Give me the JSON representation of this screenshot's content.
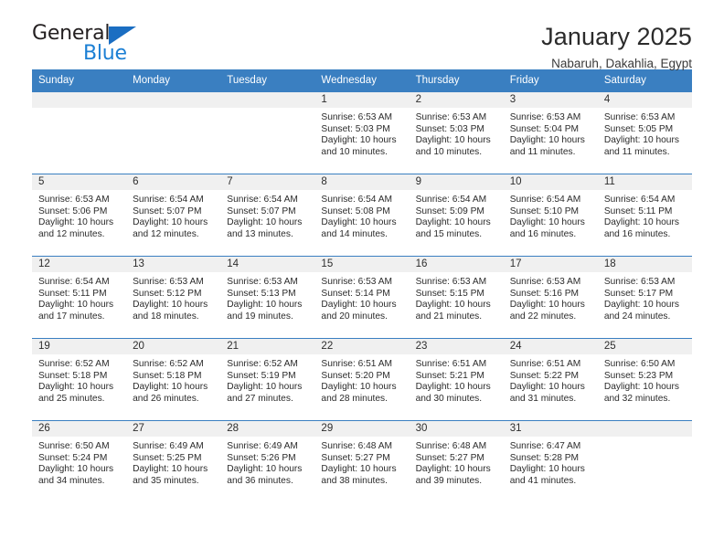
{
  "logo": {
    "word1": "General",
    "word2": "Blue",
    "triangle_color": "#1b6ec2",
    "word2_color": "#1b7fd4"
  },
  "header": {
    "title": "January 2025",
    "subtitle": "Nabaruh, Dakahlia, Egypt"
  },
  "theme": {
    "header_blue": "#3a7fc1",
    "band_gray": "#f0f0f0"
  },
  "weekdays": [
    "Sunday",
    "Monday",
    "Tuesday",
    "Wednesday",
    "Thursday",
    "Friday",
    "Saturday"
  ],
  "weeks": [
    [
      {
        "day": "",
        "empty": true
      },
      {
        "day": "",
        "empty": true
      },
      {
        "day": "",
        "empty": true
      },
      {
        "day": "1",
        "sunrise": "Sunrise: 6:53 AM",
        "sunset": "Sunset: 5:03 PM",
        "daylight": "Daylight: 10 hours and 10 minutes."
      },
      {
        "day": "2",
        "sunrise": "Sunrise: 6:53 AM",
        "sunset": "Sunset: 5:03 PM",
        "daylight": "Daylight: 10 hours and 10 minutes."
      },
      {
        "day": "3",
        "sunrise": "Sunrise: 6:53 AM",
        "sunset": "Sunset: 5:04 PM",
        "daylight": "Daylight: 10 hours and 11 minutes."
      },
      {
        "day": "4",
        "sunrise": "Sunrise: 6:53 AM",
        "sunset": "Sunset: 5:05 PM",
        "daylight": "Daylight: 10 hours and 11 minutes."
      }
    ],
    [
      {
        "day": "5",
        "sunrise": "Sunrise: 6:53 AM",
        "sunset": "Sunset: 5:06 PM",
        "daylight": "Daylight: 10 hours and 12 minutes."
      },
      {
        "day": "6",
        "sunrise": "Sunrise: 6:54 AM",
        "sunset": "Sunset: 5:07 PM",
        "daylight": "Daylight: 10 hours and 12 minutes."
      },
      {
        "day": "7",
        "sunrise": "Sunrise: 6:54 AM",
        "sunset": "Sunset: 5:07 PM",
        "daylight": "Daylight: 10 hours and 13 minutes."
      },
      {
        "day": "8",
        "sunrise": "Sunrise: 6:54 AM",
        "sunset": "Sunset: 5:08 PM",
        "daylight": "Daylight: 10 hours and 14 minutes."
      },
      {
        "day": "9",
        "sunrise": "Sunrise: 6:54 AM",
        "sunset": "Sunset: 5:09 PM",
        "daylight": "Daylight: 10 hours and 15 minutes."
      },
      {
        "day": "10",
        "sunrise": "Sunrise: 6:54 AM",
        "sunset": "Sunset: 5:10 PM",
        "daylight": "Daylight: 10 hours and 16 minutes."
      },
      {
        "day": "11",
        "sunrise": "Sunrise: 6:54 AM",
        "sunset": "Sunset: 5:11 PM",
        "daylight": "Daylight: 10 hours and 16 minutes."
      }
    ],
    [
      {
        "day": "12",
        "sunrise": "Sunrise: 6:54 AM",
        "sunset": "Sunset: 5:11 PM",
        "daylight": "Daylight: 10 hours and 17 minutes."
      },
      {
        "day": "13",
        "sunrise": "Sunrise: 6:53 AM",
        "sunset": "Sunset: 5:12 PM",
        "daylight": "Daylight: 10 hours and 18 minutes."
      },
      {
        "day": "14",
        "sunrise": "Sunrise: 6:53 AM",
        "sunset": "Sunset: 5:13 PM",
        "daylight": "Daylight: 10 hours and 19 minutes."
      },
      {
        "day": "15",
        "sunrise": "Sunrise: 6:53 AM",
        "sunset": "Sunset: 5:14 PM",
        "daylight": "Daylight: 10 hours and 20 minutes."
      },
      {
        "day": "16",
        "sunrise": "Sunrise: 6:53 AM",
        "sunset": "Sunset: 5:15 PM",
        "daylight": "Daylight: 10 hours and 21 minutes."
      },
      {
        "day": "17",
        "sunrise": "Sunrise: 6:53 AM",
        "sunset": "Sunset: 5:16 PM",
        "daylight": "Daylight: 10 hours and 22 minutes."
      },
      {
        "day": "18",
        "sunrise": "Sunrise: 6:53 AM",
        "sunset": "Sunset: 5:17 PM",
        "daylight": "Daylight: 10 hours and 24 minutes."
      }
    ],
    [
      {
        "day": "19",
        "sunrise": "Sunrise: 6:52 AM",
        "sunset": "Sunset: 5:18 PM",
        "daylight": "Daylight: 10 hours and 25 minutes."
      },
      {
        "day": "20",
        "sunrise": "Sunrise: 6:52 AM",
        "sunset": "Sunset: 5:18 PM",
        "daylight": "Daylight: 10 hours and 26 minutes."
      },
      {
        "day": "21",
        "sunrise": "Sunrise: 6:52 AM",
        "sunset": "Sunset: 5:19 PM",
        "daylight": "Daylight: 10 hours and 27 minutes."
      },
      {
        "day": "22",
        "sunrise": "Sunrise: 6:51 AM",
        "sunset": "Sunset: 5:20 PM",
        "daylight": "Daylight: 10 hours and 28 minutes."
      },
      {
        "day": "23",
        "sunrise": "Sunrise: 6:51 AM",
        "sunset": "Sunset: 5:21 PM",
        "daylight": "Daylight: 10 hours and 30 minutes."
      },
      {
        "day": "24",
        "sunrise": "Sunrise: 6:51 AM",
        "sunset": "Sunset: 5:22 PM",
        "daylight": "Daylight: 10 hours and 31 minutes."
      },
      {
        "day": "25",
        "sunrise": "Sunrise: 6:50 AM",
        "sunset": "Sunset: 5:23 PM",
        "daylight": "Daylight: 10 hours and 32 minutes."
      }
    ],
    [
      {
        "day": "26",
        "sunrise": "Sunrise: 6:50 AM",
        "sunset": "Sunset: 5:24 PM",
        "daylight": "Daylight: 10 hours and 34 minutes."
      },
      {
        "day": "27",
        "sunrise": "Sunrise: 6:49 AM",
        "sunset": "Sunset: 5:25 PM",
        "daylight": "Daylight: 10 hours and 35 minutes."
      },
      {
        "day": "28",
        "sunrise": "Sunrise: 6:49 AM",
        "sunset": "Sunset: 5:26 PM",
        "daylight": "Daylight: 10 hours and 36 minutes."
      },
      {
        "day": "29",
        "sunrise": "Sunrise: 6:48 AM",
        "sunset": "Sunset: 5:27 PM",
        "daylight": "Daylight: 10 hours and 38 minutes."
      },
      {
        "day": "30",
        "sunrise": "Sunrise: 6:48 AM",
        "sunset": "Sunset: 5:27 PM",
        "daylight": "Daylight: 10 hours and 39 minutes."
      },
      {
        "day": "31",
        "sunrise": "Sunrise: 6:47 AM",
        "sunset": "Sunset: 5:28 PM",
        "daylight": "Daylight: 10 hours and 41 minutes."
      },
      {
        "day": "",
        "empty": true
      }
    ]
  ]
}
